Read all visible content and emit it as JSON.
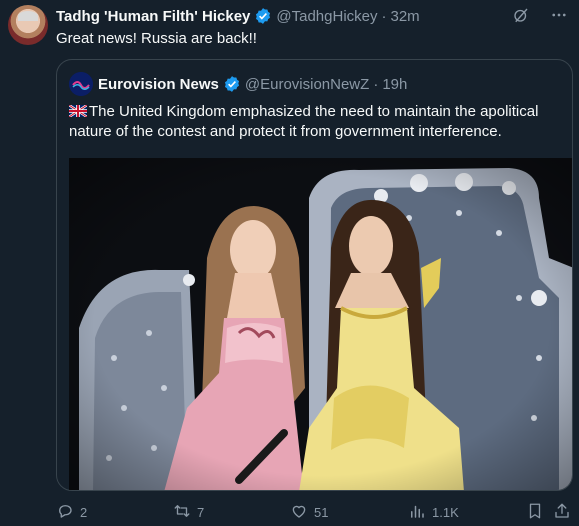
{
  "tweet": {
    "author_name": "Tadhg 'Human Filth' Hickey",
    "handle": "@TadhgHickey",
    "separator": "·",
    "time": "32m",
    "text": "Great news! Russia are back!!"
  },
  "quote": {
    "author_name": "Eurovision News",
    "handle": "@EurovisionNewZ",
    "separator": "·",
    "time": "19h",
    "text": "The United Kingdom emphasized the need to maintain the apolitical nature of the contest and protect it from government interference."
  },
  "actions": {
    "replies": "2",
    "reposts": "7",
    "likes": "51",
    "views": "1.1K"
  },
  "colors": {
    "background": "#15202b",
    "verified": "#1d9bf0",
    "muted": "#8b98a5",
    "border": "#38444d"
  },
  "icons": [
    "verified-badge-icon",
    "grok-icon",
    "more-icon",
    "uk-flag-icon",
    "reply-icon",
    "repost-icon",
    "like-icon",
    "views-icon",
    "bookmark-icon",
    "share-icon"
  ]
}
